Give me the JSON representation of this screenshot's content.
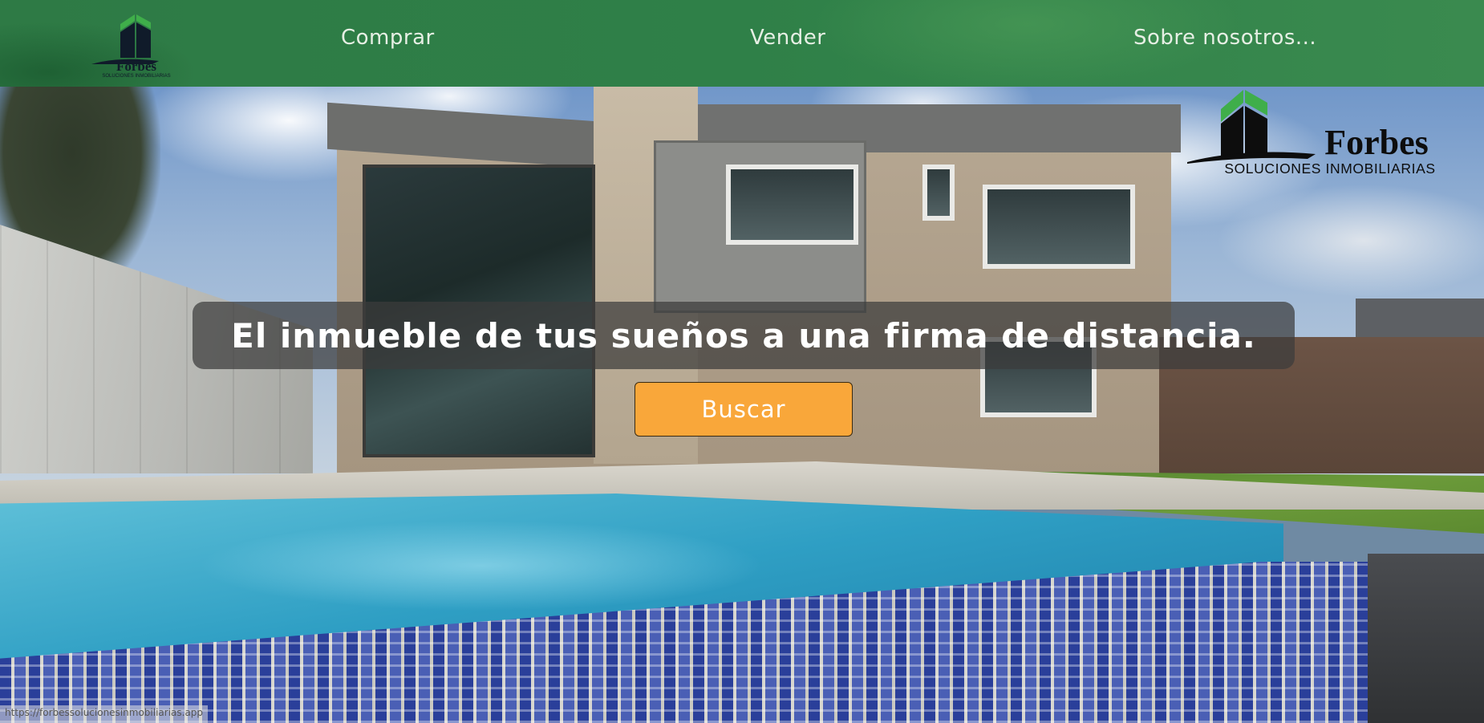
{
  "header": {
    "logo_name": "Forbes",
    "logo_subtitle": "SOLUCIONES INMOBILIARIAS",
    "nav": [
      {
        "label": "Comprar"
      },
      {
        "label": "Vender"
      },
      {
        "label": "Sobre nosotros..."
      }
    ]
  },
  "hero_logo": {
    "name": "Forbes",
    "subtitle": "SOLUCIONES INMOBILIARIAS"
  },
  "hero": {
    "tagline": "El inmueble de tus sueños a una firma de distancia.",
    "button_label": "Buscar"
  },
  "status_bar": {
    "url": "https://forbessolucionesinmobiliarias.app"
  },
  "colors": {
    "header_green": "#2f8048",
    "logo_green": "#3fae4a",
    "button_orange": "#f9a73a",
    "tagline_box": "#3c3c3c"
  }
}
